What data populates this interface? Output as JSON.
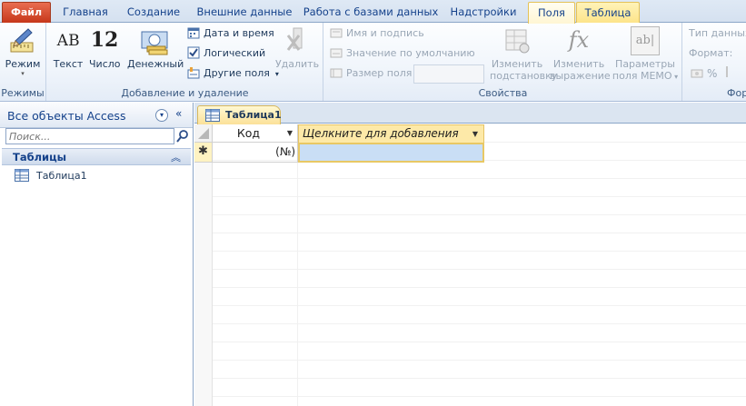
{
  "ribbon_tabs": [
    "Файл",
    "Главная",
    "Создание",
    "Внешние данные",
    "Работа с базами данных",
    "Надстройки",
    "Поля",
    "Таблица"
  ],
  "groups": {
    "modes": {
      "label": "Режимы",
      "mode_button": "Режим"
    },
    "add_delete": {
      "label": "Добавление и удаление",
      "text_button": "Текст",
      "number_button": "Число",
      "currency_button": "Денежный",
      "datetime_button": "Дата и время",
      "logical_button": "Логический",
      "other_fields_button": "Другие поля",
      "delete_button": "Удалить",
      "text_icon": "АВ",
      "number_icon": "12"
    },
    "properties": {
      "label": "Свойства",
      "name_caption": "Имя и подпись",
      "default_value": "Значение по умолчанию",
      "field_size": "Размер поля",
      "field_size_value": "",
      "change_lookup_1": "Изменить",
      "change_lookup_2": "подстановку",
      "change_expr_1": "Изменить",
      "change_expr_2": "выражение",
      "memo_params_1": "Параметры",
      "memo_params_2": "поля МЕМО",
      "fx_icon": "fx",
      "ab_icon": "ab|"
    },
    "format": {
      "datatype_label": "Тип данных",
      "format_label": "Формат:",
      "percent_symbol": "%",
      "group_label_partial": "Фор"
    }
  },
  "nav": {
    "title": "Все объекты Access",
    "drop_symbol": "⊙",
    "collapse_symbol": "«",
    "search_placeholder": "Поиск...",
    "group_label": "Таблицы",
    "group_chevron": "⌃",
    "items": [
      {
        "label": "Таблица1"
      }
    ]
  },
  "document": {
    "tab_label": "Таблица1",
    "columns": [
      "Код",
      "Щелкните для добавления"
    ],
    "new_row_marker": "✱",
    "new_row_value": "(№)"
  }
}
